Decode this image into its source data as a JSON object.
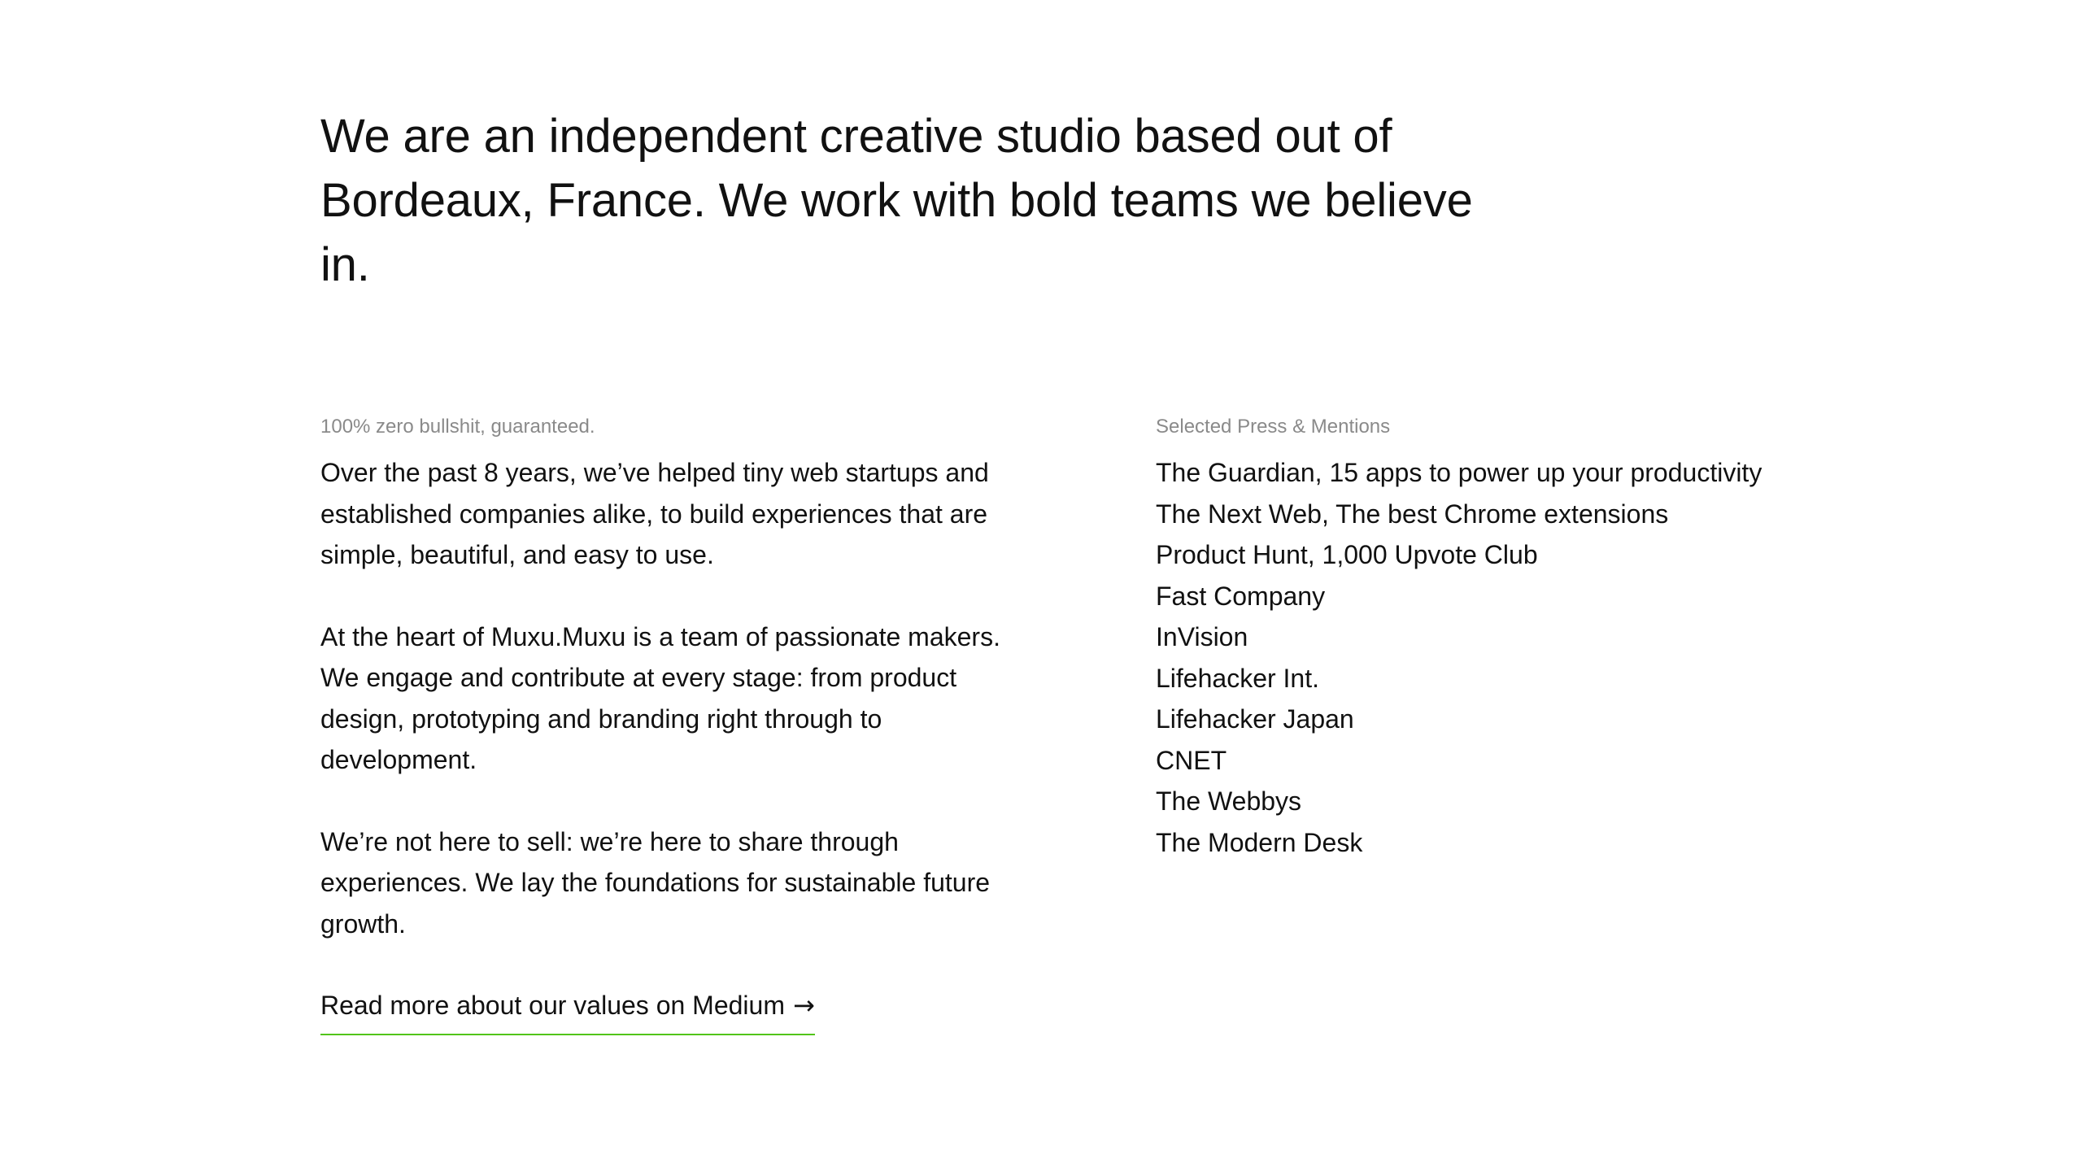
{
  "hero": {
    "text": "We are an independent creative studio based out of Bordeaux, France. We work with bold teams we believe in."
  },
  "about": {
    "eyebrow": "100% zero bullshit, guaranteed.",
    "paragraphs": [
      "Over the past 8 years, we’ve helped tiny web startups and established companies alike, to build experiences that are simple, beautiful, and easy to use.",
      "At the heart of Muxu.Muxu is a team of passionate makers. We engage and contribute at every stage: from product design, prototyping and branding right through to development.",
      "We’re not here to sell: we’re here to share through experiences. We lay the foundations for sustainable future growth."
    ],
    "link_label": "Read more about our values on Medium",
    "link_icon": "arrow-right-icon",
    "link_underline_color": "#52c41a"
  },
  "press": {
    "eyebrow": "Selected Press & Mentions",
    "items": [
      "The Guardian, 15 apps to power up your productivity",
      "The Next Web, The best Chrome extensions",
      "Product Hunt, 1,000 Upvote Club",
      "Fast Company",
      "InVision",
      "Lifehacker Int.",
      "Lifehacker Japan",
      "CNET",
      "The Webbys",
      "The Modern Desk"
    ]
  }
}
